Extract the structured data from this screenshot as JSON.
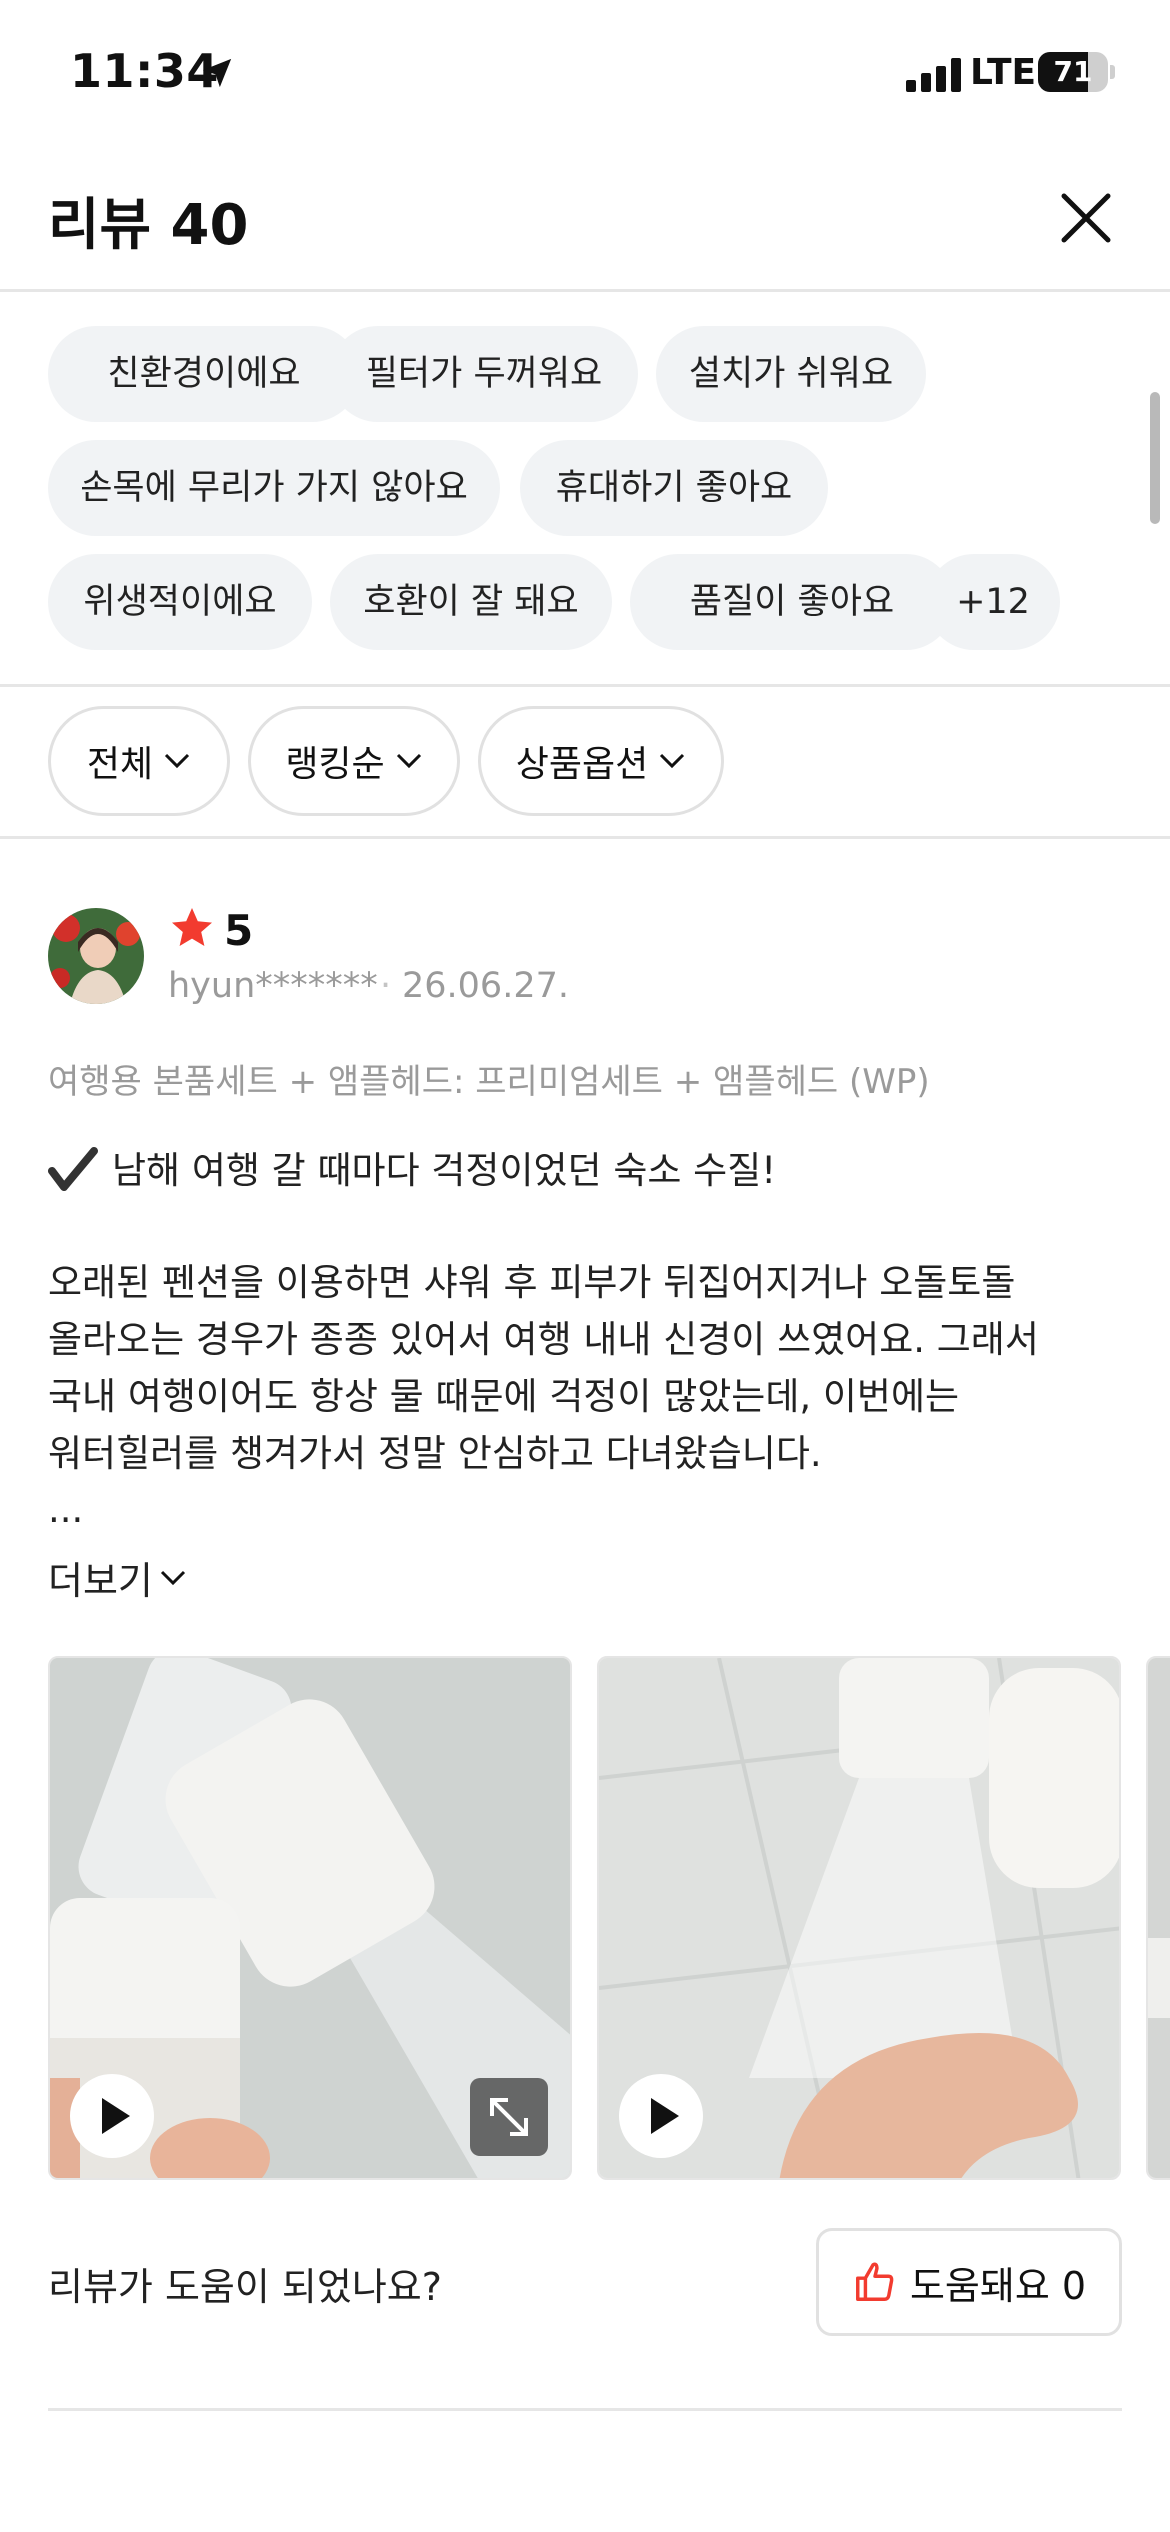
{
  "status_bar": {
    "time": "11:34",
    "network": "LTE",
    "battery_level": 71,
    "battery_label": "71"
  },
  "header": {
    "title": "리뷰 40",
    "close_icon": "close-icon"
  },
  "keywords": [
    "친환경이에요",
    "필터가 두꺼워요",
    "설치가 쉬워요",
    "손목에 무리가 가지 않아요",
    "휴대하기 좋아요",
    "위생적이에요",
    "호환이 잘 돼요",
    "품질이 좋아요",
    "+12"
  ],
  "filters": [
    {
      "label": "전체"
    },
    {
      "label": "랭킹순"
    },
    {
      "label": "상품옵션"
    }
  ],
  "review": {
    "rating": "5",
    "reviewer": "hyun*******",
    "separator": "·",
    "date": "26.06.27.",
    "option": "여행용 본품세트 + 앰플헤드: 프리미엄세트 + 앰플헤드 (WP)",
    "headline": "남해 여행 갈 때마다 걱정이었던 숙소 수질!",
    "body": "오래된 펜션을 이용하면 샤워 후 피부가 뒤집어지거나 오돌토돌\n올라오는 경우가 종종 있어서 여행 내내 신경이 쓰였어요. 그래서\n국내 여행이어도 항상 물 때문에 걱정이 많았는데, 이번에는\n워터힐러를 챙겨가서 정말 안심하고 다녀왔습니다.",
    "ellipsis": "...",
    "more_label": "더보기"
  },
  "helpful": {
    "question": "리뷰가 도움이 되었나요?",
    "button_label": "도움돼요 0"
  },
  "colors": {
    "accent_red": "#f23b2f",
    "chip_bg": "#f1f3f5",
    "muted_text": "#9a9a9a"
  }
}
